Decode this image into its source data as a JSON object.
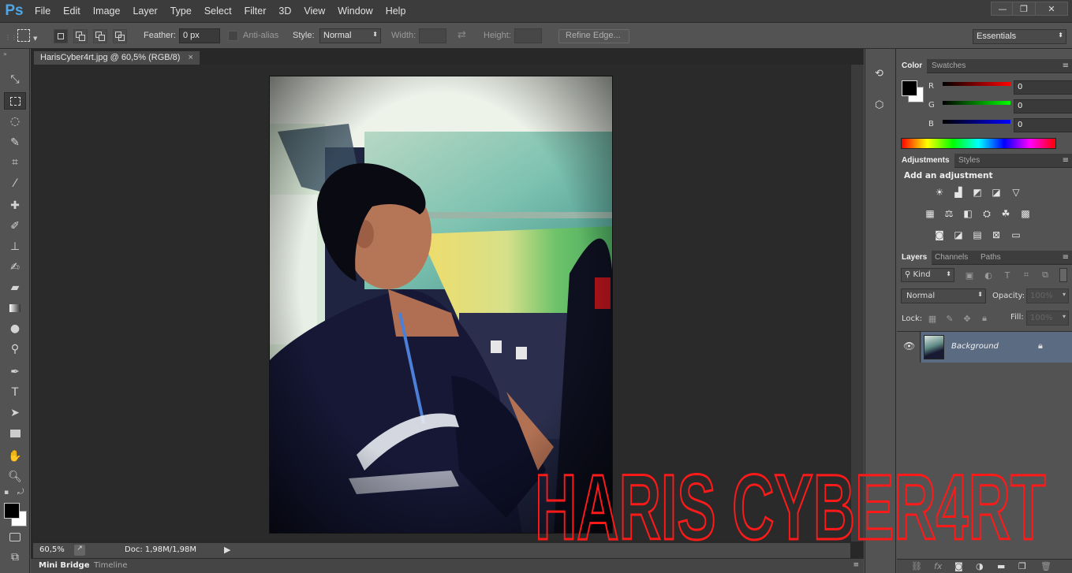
{
  "app": {
    "logo": "Ps"
  },
  "menu": [
    "File",
    "Edit",
    "Image",
    "Layer",
    "Type",
    "Select",
    "Filter",
    "3D",
    "View",
    "Window",
    "Help"
  ],
  "window_controls": {
    "minimize": "—",
    "restore": "❐",
    "close": "✕"
  },
  "options": {
    "feather_label": "Feather:",
    "feather_value": "0 px",
    "antialias_label": "Anti-alias",
    "style_label": "Style:",
    "style_value": "Normal",
    "width_label": "Width:",
    "height_label": "Height:",
    "refine_edge": "Refine Edge...",
    "workspace": "Essentials"
  },
  "document": {
    "tab_title": "HarisCyber4rt.jpg @ 60,5% (RGB/8)",
    "close": "×",
    "zoom": "60,5%",
    "doc_size": "Doc: 1,98M/1,98M"
  },
  "bottom_tabs": [
    "Mini Bridge",
    "Timeline"
  ],
  "color_panel": {
    "tabs": [
      "Color",
      "Swatches"
    ],
    "r_label": "R",
    "g_label": "G",
    "b_label": "B",
    "r": "0",
    "g": "0",
    "b": "0"
  },
  "adjustments_panel": {
    "tabs": [
      "Adjustments",
      "Styles"
    ],
    "heading": "Add an adjustment",
    "icons": [
      "brightness-icon",
      "levels-icon",
      "curves-icon",
      "exposure-icon",
      "vibrance-icon",
      "hue-saturation-icon",
      "color-balance-icon",
      "black-white-icon",
      "photo-filter-icon",
      "channel-mixer-icon",
      "color-lookup-icon",
      "invert-icon",
      "posterize-icon",
      "threshold-icon",
      "selective-color-icon",
      "gradient-map-icon"
    ]
  },
  "layers_panel": {
    "tabs": [
      "Layers",
      "Channels",
      "Paths"
    ],
    "filter_kind": "Kind",
    "blend_mode": "Normal",
    "opacity_label": "Opacity:",
    "opacity_value": "100%",
    "lock_label": "Lock:",
    "fill_label": "Fill:",
    "fill_value": "100%",
    "layers": [
      {
        "name": "Background",
        "visible": true,
        "locked": true
      }
    ]
  },
  "watermark": {
    "text": "HARIS CYBER4RT",
    "color": "#ff1a1a"
  },
  "colors": {
    "accent": "#4ea7e8",
    "selected_layer": "#5b6b82",
    "panel_bg": "#535353"
  }
}
